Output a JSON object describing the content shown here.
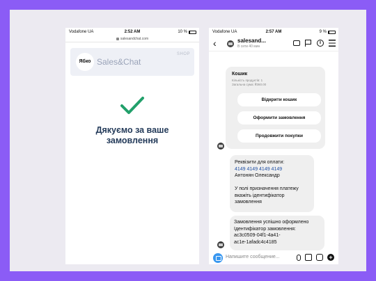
{
  "left_phone": {
    "status": {
      "carrier": "Vodafone UA",
      "time": "2:52 AM",
      "battery": "10 %",
      "battery_level": 0.1
    },
    "url": "salesandchat.com",
    "banner": {
      "logo_text": "Ябко",
      "brand": "Sales&Chat",
      "tag": "SHOP"
    },
    "thanks_line1": "Дякуємо за ваше",
    "thanks_line2": "замовлення"
  },
  "right_phone": {
    "status": {
      "carrier": "Vodafone UA",
      "time": "2:57 AM",
      "battery": "9 %",
      "battery_level": 0.09
    },
    "header": {
      "name": "salesand...",
      "subtitle": "В сети 40 мин"
    },
    "cart": {
      "title": "Кошик",
      "meta_line1": "Кількість продуктів: 1",
      "meta_line2": "Загальна сума: ₴360.00",
      "buttons": [
        "Відкрити кошик",
        "Оформити замовлення",
        "Продовжити покупки"
      ]
    },
    "payment": {
      "line1": "Реквізити для оплати:",
      "card_number": "4149 4149 4149 4149",
      "name": "Антонян Олександр",
      "note1": "У полі призначення платежу",
      "note2": "вкажіть ідентифікатор",
      "note3": "замовлення"
    },
    "order": {
      "line1": "Замовлення успішно оформлено",
      "line2": "Ідентифікатор замовлення:",
      "line3": "ac3c0509-04f1-4a41-",
      "line4": "ac1e-1afadc4c4185"
    },
    "composer_placeholder": "Напишите сообщение..."
  },
  "colors": {
    "background": "#8b5cf6",
    "check": "#22a06b",
    "accent": "#3897f0"
  }
}
